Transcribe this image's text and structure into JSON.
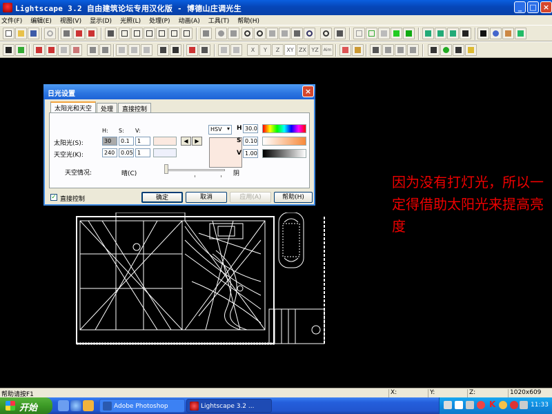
{
  "window": {
    "title": "Lightscape 3.2 自由建筑论坛专用汉化版  - 博德山庄调光生",
    "controls": {
      "minimize": "_",
      "maximize": "□",
      "close": "×"
    }
  },
  "menu": [
    "文件(F)",
    "编辑(E)",
    "视图(V)",
    "显示(D)",
    "光照(L)",
    "处理(P)",
    "动画(A)",
    "工具(T)",
    "帮助(H)"
  ],
  "toolbar2_text": {
    "x": "X",
    "y": "Y",
    "z": "Z",
    "xy": "XY",
    "zx": "ZX",
    "yz": "YZ",
    "aim": "Aim"
  },
  "dialog": {
    "title": "日光设置",
    "close": "×",
    "tabs": [
      "太阳光和天空",
      "处理",
      "直接控制"
    ],
    "column_headers": {
      "h": "H:",
      "s": "S:",
      "v": "V:"
    },
    "sunlight": {
      "label": "太阳光(S):",
      "h": "30",
      "s": "0.1",
      "v": "1"
    },
    "skylight": {
      "label": "天空光(K):",
      "h": "240",
      "s": "0.05",
      "v": "1"
    },
    "colormode": {
      "selected": "HSV"
    },
    "hsv_fields": {
      "h_label": "H",
      "h_value": "30.0",
      "s_label": "S",
      "s_value": "0.10",
      "v_label": "V",
      "v_value": "1.00"
    },
    "sky_condition": {
      "label": "天空情况:",
      "left": "晴(C)",
      "right": "阴"
    },
    "direct_control": {
      "label": "直接控制",
      "checked": "✓"
    },
    "buttons": {
      "ok": "确定",
      "cancel": "取消",
      "apply": "应用(A)",
      "help": "帮助(H)"
    },
    "arrows": {
      "left": "◀",
      "right": "▶"
    },
    "colors": {
      "sun_swatch": "#fbe9e0",
      "sky_swatch": "#eef0fb"
    }
  },
  "annotation": {
    "text": "因为没有打灯光，所以一定得借助太阳光来提高亮度",
    "color": "#e00000"
  },
  "statusbar": {
    "help": "帮助请按F1",
    "x": "X:",
    "y": "Y:",
    "z": "Z:",
    "resolution": "1020x609"
  },
  "taskbar": {
    "start": "开始",
    "tasks": [
      "Adobe Photoshop",
      "Lightscape 3.2 ..."
    ],
    "clock": "11:33"
  }
}
